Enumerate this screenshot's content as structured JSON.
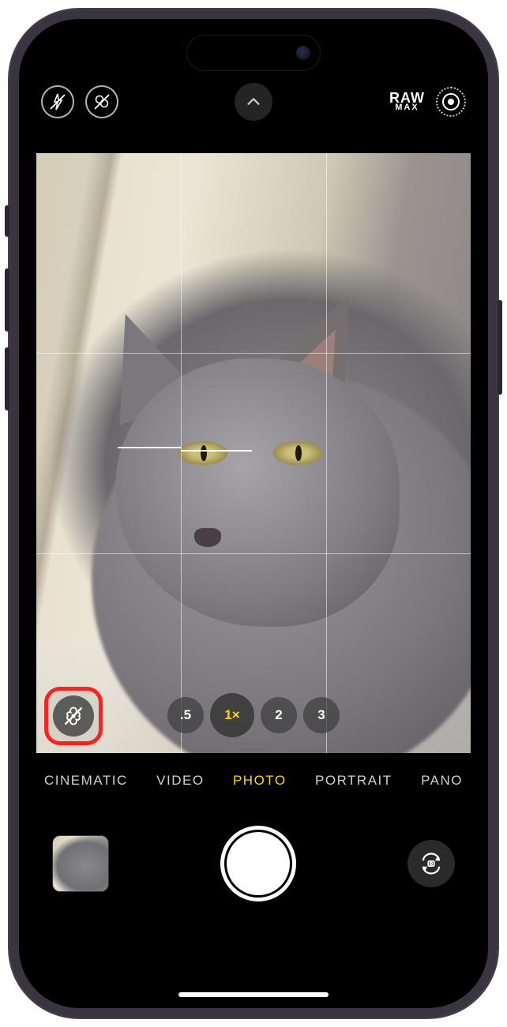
{
  "top_controls": {
    "raw_top": "RAW",
    "raw_bot": "MAX"
  },
  "zoom": {
    "levels": [
      ".5",
      "1×",
      "2",
      "3"
    ],
    "active_index": 1
  },
  "modes": {
    "items": [
      "CINEMATIC",
      "VIDEO",
      "PHOTO",
      "PORTRAIT",
      "PANO"
    ],
    "active_index": 2
  },
  "colors": {
    "highlight": "#ff2020",
    "accent": "#ffd60a"
  }
}
